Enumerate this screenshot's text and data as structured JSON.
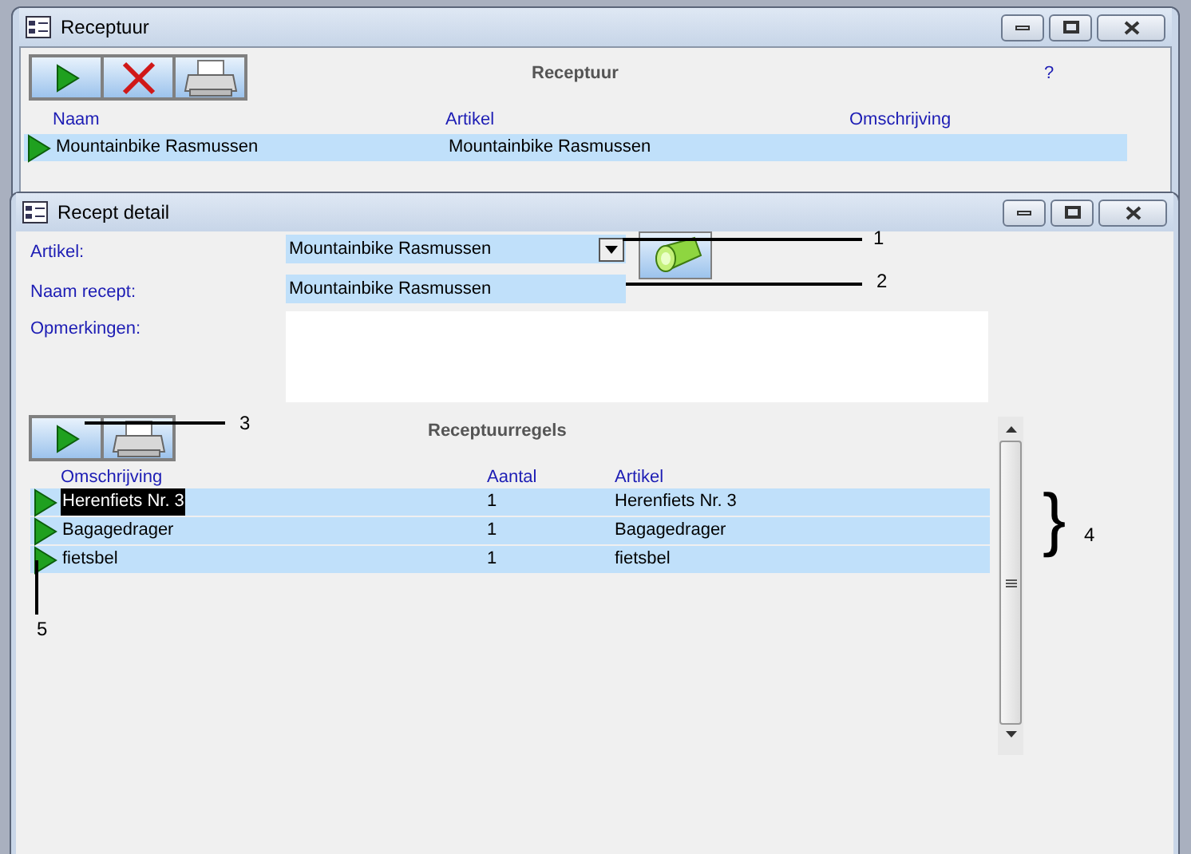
{
  "list_window": {
    "title": "Receptuur",
    "heading": "Receptuur",
    "help": "?",
    "columns": [
      "Naam",
      "Artikel",
      "Omschrijving"
    ],
    "rows": [
      {
        "naam": "Mountainbike Rasmussen",
        "artikel": "Mountainbike Rasmussen"
      }
    ]
  },
  "detail_window": {
    "title": "Recept detail",
    "fields": [
      {
        "kind": "dropdown",
        "label": "Artikel:",
        "value": "Mountainbike Rasmussen"
      },
      {
        "kind": "text",
        "label": "Naam recept:",
        "value": "Mountainbike Rasmussen"
      },
      {
        "kind": "memo",
        "label": "Opmerkingen:"
      }
    ],
    "subform": {
      "heading": "Receptuurregels",
      "columns": [
        "Omschrijving",
        "Aantal",
        "Artikel"
      ],
      "rows": [
        {
          "omschrijving": "Herenfiets Nr. 3",
          "aantal": "1",
          "artikel": "Herenfiets Nr. 3",
          "selected": true
        },
        {
          "omschrijving": "Bagagedrager",
          "aantal": "1",
          "artikel": "Bagagedrager",
          "selected": false
        },
        {
          "omschrijving": "fietsbel",
          "aantal": "1",
          "artikel": "fietsbel",
          "selected": false
        }
      ]
    }
  },
  "callouts": [
    "1",
    "2",
    "3",
    "4",
    "5"
  ],
  "brace": "}"
}
